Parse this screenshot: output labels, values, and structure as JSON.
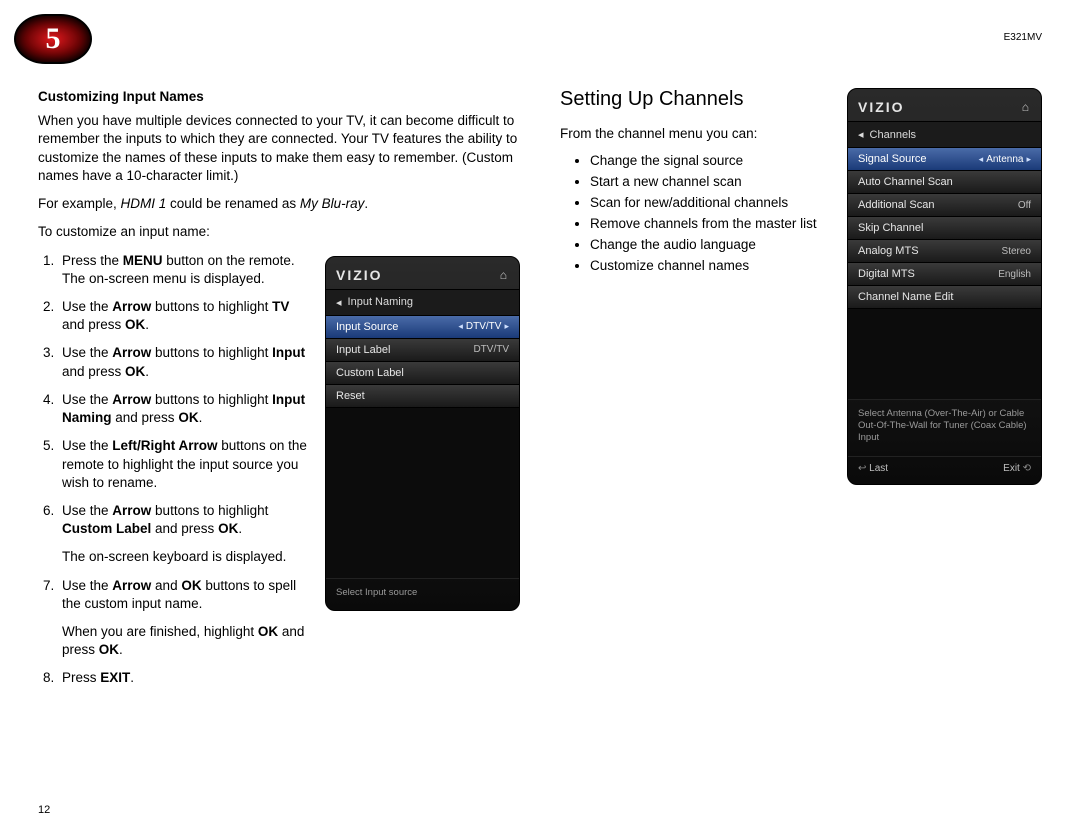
{
  "chapter_number": "5",
  "model": "E321MV",
  "page_number": "12",
  "left": {
    "heading": "Customizing Input Names",
    "intro": "When you have multiple devices connected to your TV, it can become difficult to remember the inputs to which they are connected. Your TV features the ability to customize the names of these inputs to make them easy to remember. (Custom names have a 10-character limit.)",
    "example_pre": "For example, ",
    "example_i1": "HDMI 1",
    "example_mid": " could be renamed as ",
    "example_i2": "My Blu-ray",
    "example_end": ".",
    "to_customize": "To customize an input name:",
    "steps": {
      "s1a": "Press the ",
      "s1b": "MENU",
      "s1c": " button on the remote. The on-screen menu is displayed.",
      "s2a": "Use the ",
      "s2b": "Arrow",
      "s2c": " buttons to highlight ",
      "s2d": "TV",
      "s2e": " and press ",
      "s2f": "OK",
      "s2g": ".",
      "s3a": "Use the ",
      "s3b": "Arrow",
      "s3c": " buttons to highlight ",
      "s3d": "Input",
      "s3e": " and press ",
      "s3f": "OK",
      "s3g": ".",
      "s4a": "Use the ",
      "s4b": "Arrow",
      "s4c": " buttons to highlight ",
      "s4d": "Input Naming",
      "s4e": " and press ",
      "s4f": "OK",
      "s4g": ".",
      "s5a": "Use the ",
      "s5b": "Left/Right Arrow",
      "s5c": " buttons on the remote to highlight the input source you wish to rename.",
      "s6a": "Use the ",
      "s6b": "Arrow",
      "s6c": " buttons to highlight ",
      "s6d": "Custom Label",
      "s6e": " and press ",
      "s6f": "OK",
      "s6g": ".",
      "s6_after": "The on-screen keyboard is displayed.",
      "s7a": "Use the ",
      "s7b": "Arrow",
      "s7c": " and ",
      "s7d": "OK",
      "s7e": " buttons to spell the custom input name.",
      "s7_after_a": "When you are finished, highlight ",
      "s7_after_b": "OK",
      "s7_after_c": " and press ",
      "s7_after_d": "OK",
      "s7_after_e": ".",
      "s8a": "Press ",
      "s8b": "EXIT",
      "s8c": "."
    }
  },
  "tv1": {
    "brand": "VIZIO",
    "breadcrumb": "Input Naming",
    "rows": [
      {
        "label": "Input Source",
        "value": "DTV/TV",
        "selected": true,
        "arrows": true
      },
      {
        "label": "Input Label",
        "value": "DTV/TV",
        "selected": false,
        "arrows": false
      },
      {
        "label": "Custom Label",
        "value": "",
        "selected": false,
        "arrows": false
      },
      {
        "label": "Reset",
        "value": "",
        "selected": false,
        "arrows": false
      }
    ],
    "hint": "Select Input source"
  },
  "right": {
    "heading": "Setting Up Channels",
    "intro": "From the channel menu you can:",
    "bullets": [
      "Change the signal source",
      "Start a new channel scan",
      "Scan for new/additional channels",
      "Remove channels from the master list",
      "Change the audio language",
      "Customize channel names"
    ]
  },
  "tv2": {
    "brand": "VIZIO",
    "breadcrumb": "Channels",
    "rows": [
      {
        "label": "Signal Source",
        "value": "Antenna",
        "selected": true,
        "arrows": true
      },
      {
        "label": "Auto Channel Scan",
        "value": "",
        "selected": false
      },
      {
        "label": "Additional Scan",
        "value": "Off",
        "selected": false
      },
      {
        "label": "Skip Channel",
        "value": "",
        "selected": false
      },
      {
        "label": "Analog MTS",
        "value": "Stereo",
        "selected": false
      },
      {
        "label": "Digital MTS",
        "value": "English",
        "selected": false
      },
      {
        "label": "Channel Name Edit",
        "value": "",
        "selected": false
      }
    ],
    "hint": "Select Antenna (Over-The-Air) or Cable Out-Of-The-Wall for Tuner (Coax Cable) Input",
    "foot_last": "Last",
    "foot_exit": "Exit"
  }
}
